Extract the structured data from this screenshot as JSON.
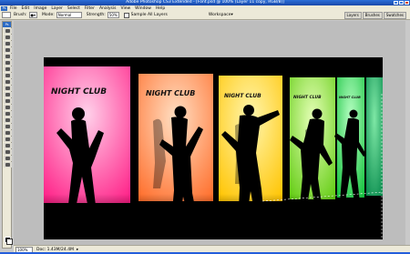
{
  "window": {
    "title": "Adobe Photoshop CS3 Extended - [Font.psd @ 100% (Layer 11 copy, RGB/8)]"
  },
  "app_logo": "Ps",
  "menu": [
    "File",
    "Edit",
    "Image",
    "Layer",
    "Select",
    "Filter",
    "Analysis",
    "View",
    "Window",
    "Help"
  ],
  "options": {
    "brush_label": "Brush:",
    "mode_label": "Mode:",
    "mode_value": "Normal",
    "strength_label": "Strength:",
    "strength_value": "50%",
    "sample_all_layers": "Sample All Layers",
    "workspace_label": "Workspace"
  },
  "palette_wells": [
    "Layers",
    "Brushes",
    "Swatches"
  ],
  "canvas_text": {
    "banner": "NIGHT CLUB"
  },
  "status": {
    "zoom": "100%",
    "doc": "Doc: 1.43M/24.4M"
  },
  "colors": {
    "panels": [
      "#ff2d8a",
      "#ff7f3a",
      "#ffd200",
      "#7fdc1f",
      "#2bd34b",
      "#0ea25e"
    ]
  }
}
